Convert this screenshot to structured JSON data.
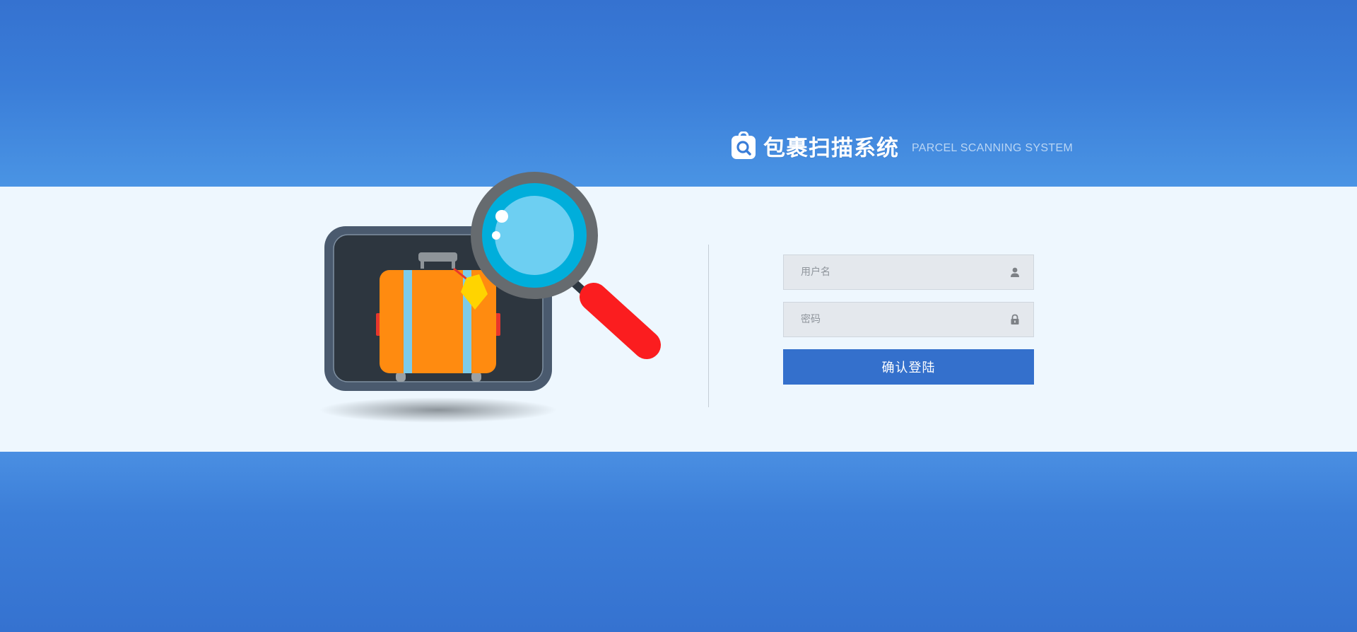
{
  "brand": {
    "title": "包裹扫描系统",
    "subtitle": "PARCEL SCANNING SYSTEM",
    "logo_icon": "bag-search-icon"
  },
  "illustration": {
    "name": "suitcase-magnifier-illustration"
  },
  "login": {
    "username_placeholder": "用户名",
    "username_value": "",
    "username_icon": "user-icon",
    "password_placeholder": "密码",
    "password_value": "",
    "password_icon": "lock-icon",
    "submit_label": "确认登陆"
  },
  "colors": {
    "band_blue": "#3572d0",
    "band_light": "#4a94e4",
    "panel_bg": "#eef7fe",
    "button_blue": "#3470cc",
    "field_bg": "#e4e8ed"
  }
}
